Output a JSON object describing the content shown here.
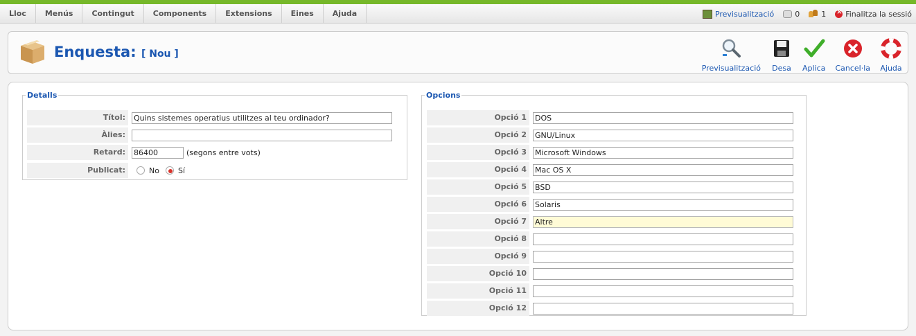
{
  "menubar": {
    "items": [
      "Lloc",
      "Menús",
      "Contingut",
      "Components",
      "Extensions",
      "Eines",
      "Ajuda"
    ],
    "status": {
      "preview_label": "Previsualització",
      "messages_count": "0",
      "users_count": "1",
      "logout_label": "Finalitza la sessió"
    }
  },
  "header": {
    "title": "Enquesta:",
    "subtitle": "[ Nou ]",
    "buttons": {
      "preview": "Previsualització",
      "save": "Desa",
      "apply": "Aplica",
      "cancel": "Cancel·la",
      "help": "Ajuda"
    }
  },
  "details": {
    "legend": "Detalls",
    "title_label": "Títol:",
    "title_value": "Quins sistemes operatius utilitzes al teu ordinador?",
    "alias_label": "Àlies:",
    "alias_value": "",
    "lag_label": "Retard:",
    "lag_value": "86400",
    "lag_hint": "(segons entre vots)",
    "published_label": "Publicat:",
    "published_no": "No",
    "published_yes": "Sí",
    "published_selected": "Sí"
  },
  "options": {
    "legend": "Opcions",
    "items": [
      {
        "label": "Opció 1",
        "value": "DOS"
      },
      {
        "label": "Opció 2",
        "value": "GNU/Linux"
      },
      {
        "label": "Opció 3",
        "value": "Microsoft Windows"
      },
      {
        "label": "Opció 4",
        "value": "Mac OS X"
      },
      {
        "label": "Opció 5",
        "value": "BSD"
      },
      {
        "label": "Opció 6",
        "value": "Solaris"
      },
      {
        "label": "Opció 7",
        "value": "Altre"
      },
      {
        "label": "Opció 8",
        "value": ""
      },
      {
        "label": "Opció 9",
        "value": ""
      },
      {
        "label": "Opció 10",
        "value": ""
      },
      {
        "label": "Opció 11",
        "value": ""
      },
      {
        "label": "Opció 12",
        "value": ""
      }
    ]
  },
  "colors": {
    "accent": "#1b57b1",
    "top_bar": "#76b82a",
    "focused_input": "#fffbd6"
  }
}
